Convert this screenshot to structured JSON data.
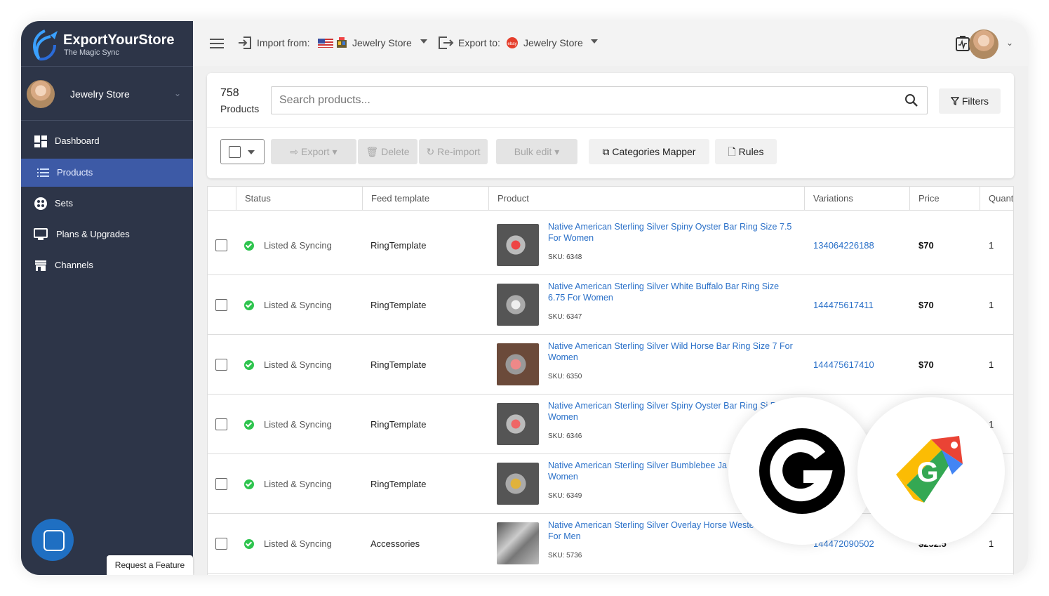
{
  "brand": {
    "name": "ExportYourStore",
    "tagline": "The Magic Sync"
  },
  "sidebar": {
    "store_name": "Jewelry Store",
    "items": [
      {
        "label": "Dashboard",
        "icon": "dashboard-icon"
      },
      {
        "label": "Products",
        "icon": "list-icon",
        "active": true
      },
      {
        "label": "Sets",
        "icon": "sets-icon"
      },
      {
        "label": "Plans & Upgrades",
        "icon": "monitor-icon"
      },
      {
        "label": "Channels",
        "icon": "store-icon"
      }
    ],
    "request_feature": "Request a Feature"
  },
  "topbar": {
    "import_label": "Import from:",
    "import_store": "Jewelry Store",
    "export_label": "Export to:",
    "export_store": "Jewelry Store"
  },
  "products": {
    "count": "758",
    "count_label": "Products",
    "search_placeholder": "Search products...",
    "filters": "Filters"
  },
  "toolbar": {
    "export": "Export",
    "delete": "Delete",
    "reimport": "Re-import",
    "bulk_edit": "Bulk edit",
    "categories_mapper": "Categories Mapper",
    "rules": "Rules"
  },
  "table": {
    "headers": [
      "Status",
      "Feed template",
      "Product",
      "Variations",
      "Price",
      "Quant"
    ],
    "rows": [
      {
        "status": "Listed & Syncing",
        "template": "RingTemplate",
        "title": "Native American Sterling Silver Spiny Oyster Bar Ring Size 7.5 For Women",
        "sku": "SKU: 6348",
        "variation": "134064226188",
        "price": "$70",
        "qty": "1"
      },
      {
        "status": "Listed & Syncing",
        "template": "RingTemplate",
        "title": "Native American Sterling Silver White Buffalo Bar Ring Size 6.75 For Women",
        "sku": "SKU: 6347",
        "variation": "144475617411",
        "price": "$70",
        "qty": "1"
      },
      {
        "status": "Listed & Syncing",
        "template": "RingTemplate",
        "title": "Native American Sterling Silver Wild Horse Bar Ring Size 7 For Women",
        "sku": "SKU: 6350",
        "variation": "144475617410",
        "price": "$70",
        "qty": "1"
      },
      {
        "status": "Listed & Syncing",
        "template": "RingTemplate",
        "title": "Native American Sterling Silver Spiny Oyster Bar Ring Si For Women",
        "sku": "SKU: 6346",
        "variation": "105",
        "price": "",
        "qty": "1"
      },
      {
        "status": "Listed & Syncing",
        "template": "RingTemplate",
        "title": "Native American Sterling Silver Bumblebee Ja Size 7 For Women",
        "sku": "SKU: 6349",
        "variation": "",
        "price": "",
        "qty": ""
      },
      {
        "status": "Listed & Syncing",
        "template": "Accessories",
        "title": "Native American Sterling Silver Overlay Horse Weste Buckle For Men",
        "sku": "SKU: 5736",
        "variation": "144472090502",
        "price": "$252.5",
        "qty": "1"
      }
    ]
  },
  "overlay_icons": [
    "google-shopping-g-icon",
    "google-merchant-tag-icon"
  ],
  "colors": {
    "sidebar": "#2d3548",
    "active": "#3d5aa6",
    "link": "#2a70c8",
    "ok": "#2ec44e"
  }
}
